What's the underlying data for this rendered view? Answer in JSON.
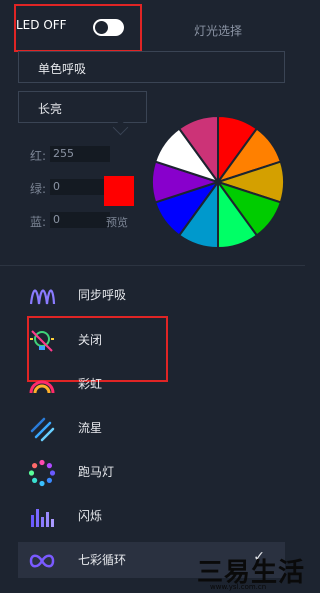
{
  "header": {
    "led_label": "LED OFF",
    "led_toggle_state": "off",
    "light_select_label": "灯光选择"
  },
  "mode": {
    "selected": "单色呼吸",
    "sub_selected": "长亮"
  },
  "rgb": {
    "red_label": "红:",
    "red_value": "255",
    "green_label": "绿:",
    "green_value": "0",
    "blue_label": "蓝:",
    "blue_value": "0"
  },
  "preview": {
    "label": "预览",
    "color": "#ff0000"
  },
  "color_wheel": {
    "segments": [
      "#ff0000",
      "#ff8000",
      "#d4a000",
      "#00cc00",
      "#00ff66",
      "#0099cc",
      "#0000ff",
      "#8800cc",
      "#ffffff",
      "#cc3377"
    ]
  },
  "effects": [
    {
      "label": "同步呼吸",
      "icon": "breathing-wave-icon"
    },
    {
      "label": "关闭",
      "icon": "bulb-off-icon"
    },
    {
      "label": "彩虹",
      "icon": "rainbow-icon"
    },
    {
      "label": "流星",
      "icon": "meteor-icon"
    },
    {
      "label": "跑马灯",
      "icon": "marquee-dots-icon"
    },
    {
      "label": "闪烁",
      "icon": "flash-bars-icon"
    },
    {
      "label": "七彩循环",
      "icon": "infinity-loop-icon",
      "selected": true
    }
  ],
  "watermark": {
    "text": "三易生活",
    "sub": "www.ysl.com.cn"
  },
  "colors": {
    "background": "#1d2430",
    "highlight_border": "#e02525",
    "selected_row": "#2a3140"
  }
}
